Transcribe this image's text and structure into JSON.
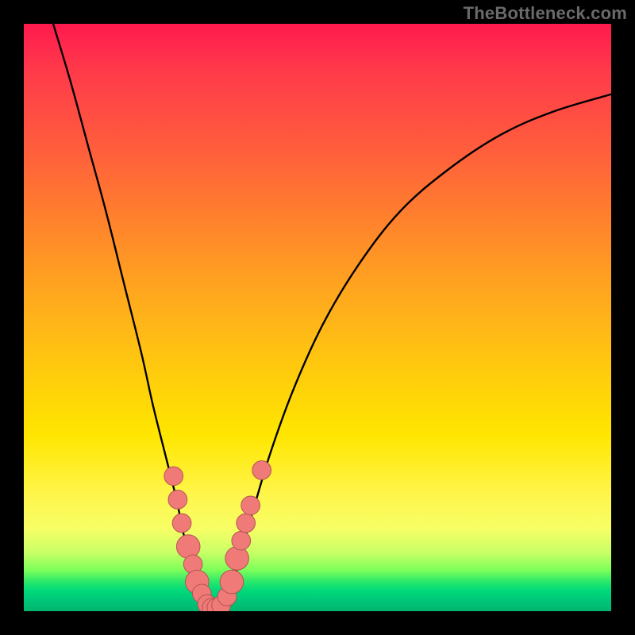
{
  "watermark": "TheBottleneck.com",
  "chart_data": {
    "type": "line",
    "title": "",
    "xlabel": "",
    "ylabel": "",
    "xlim": [
      0,
      100
    ],
    "ylim": [
      0,
      100
    ],
    "grid": false,
    "series": [
      {
        "name": "left-curve",
        "x": [
          5,
          8,
          11,
          14,
          17,
          20,
          22,
          24,
          26,
          27,
          28,
          29,
          30,
          31
        ],
        "y": [
          100,
          90,
          79,
          68,
          56,
          44,
          35,
          27,
          19,
          14,
          10,
          6,
          3,
          1
        ]
      },
      {
        "name": "right-curve",
        "x": [
          34,
          35,
          36,
          37,
          39,
          42,
          46,
          51,
          57,
          64,
          72,
          81,
          90,
          100
        ],
        "y": [
          1,
          3,
          6,
          10,
          17,
          27,
          38,
          49,
          59,
          68,
          75,
          81,
          85,
          88
        ]
      },
      {
        "name": "valley-floor",
        "x": [
          31,
          32,
          33,
          34
        ],
        "y": [
          1,
          0.5,
          0.5,
          1
        ]
      }
    ],
    "markers": [
      {
        "x": 25.5,
        "y": 23,
        "r": 1.6
      },
      {
        "x": 26.2,
        "y": 19,
        "r": 1.6
      },
      {
        "x": 26.9,
        "y": 15,
        "r": 1.6
      },
      {
        "x": 28.0,
        "y": 11,
        "r": 2.0
      },
      {
        "x": 28.8,
        "y": 8,
        "r": 1.6
      },
      {
        "x": 29.5,
        "y": 5,
        "r": 2.0
      },
      {
        "x": 30.3,
        "y": 3,
        "r": 1.6
      },
      {
        "x": 31.2,
        "y": 1.2,
        "r": 1.6
      },
      {
        "x": 32.0,
        "y": 0.6,
        "r": 1.6
      },
      {
        "x": 32.8,
        "y": 0.6,
        "r": 1.6
      },
      {
        "x": 33.6,
        "y": 1.0,
        "r": 1.6
      },
      {
        "x": 34.6,
        "y": 2.5,
        "r": 1.6
      },
      {
        "x": 35.4,
        "y": 5,
        "r": 2.0
      },
      {
        "x": 36.3,
        "y": 9,
        "r": 2.0
      },
      {
        "x": 37.0,
        "y": 12,
        "r": 1.6
      },
      {
        "x": 37.8,
        "y": 15,
        "r": 1.6
      },
      {
        "x": 38.6,
        "y": 18,
        "r": 1.6
      },
      {
        "x": 40.5,
        "y": 24,
        "r": 1.6
      }
    ],
    "colors": {
      "curve": "#000000",
      "marker_fill": "#ef7a78",
      "marker_stroke": "#b45552"
    }
  }
}
